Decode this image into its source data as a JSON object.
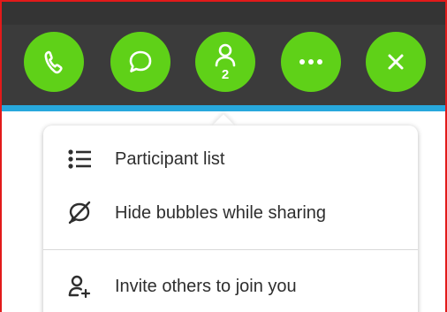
{
  "toolbar": {
    "buttons": [
      {
        "name": "call",
        "icon": "phone-icon"
      },
      {
        "name": "chat",
        "icon": "chat-bubble-icon"
      },
      {
        "name": "participants",
        "icon": "person-icon",
        "badge": "2"
      },
      {
        "name": "more",
        "icon": "ellipsis-icon"
      },
      {
        "name": "close",
        "icon": "close-icon"
      }
    ],
    "accent_color": "#5fd118",
    "bar_color": "#3b3b3b",
    "strip_color": "#27a8dc"
  },
  "menu": {
    "items": [
      {
        "label": "Participant list",
        "icon": "list-icon"
      },
      {
        "label": "Hide bubbles while sharing",
        "icon": "hide-bubbles-icon"
      },
      {
        "label": "Invite others to join you",
        "icon": "add-person-icon"
      }
    ]
  }
}
